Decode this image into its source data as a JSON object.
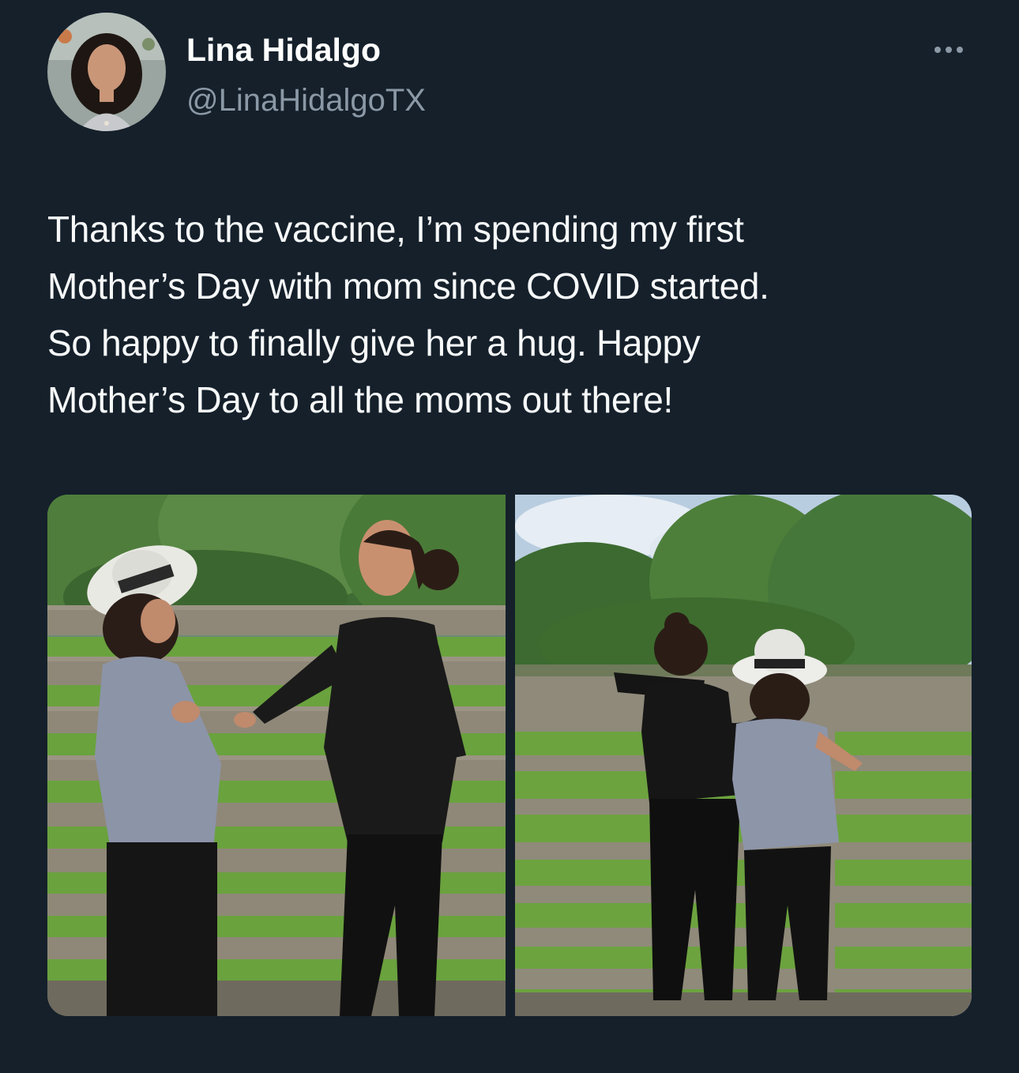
{
  "author": {
    "display_name": "Lina Hidalgo",
    "handle": "@LinaHidalgoTX",
    "avatar_icon": "profile-photo"
  },
  "more_icon": "more-horizontal-icon",
  "tweet": {
    "text_lines": [
      "Thanks to the vaccine, I’m spending my first",
      "Mother’s Day with mom since COVID started.",
      "So happy to finally give her a hug. Happy",
      "Mother’s Day to all the moms out there!"
    ]
  },
  "media": [
    {
      "kind": "photo"
    },
    {
      "kind": "photo"
    }
  ],
  "colors": {
    "background": "#15202b",
    "text_primary": "#f7f9f9",
    "text_secondary": "#8b98a5"
  }
}
